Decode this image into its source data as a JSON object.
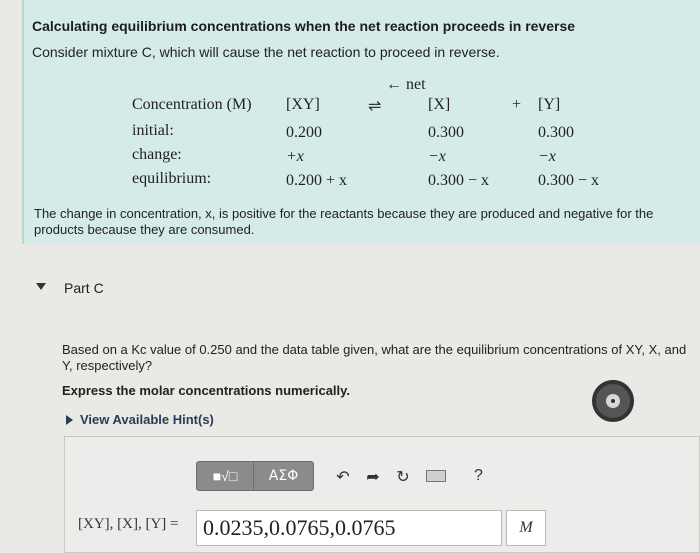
{
  "info": {
    "title": "Calculating equilibrium concentrations when the net reaction proceeds in reverse",
    "subtitle": "Consider mixture C, which will cause the net reaction to proceed in reverse.",
    "net_arrow": "← net",
    "eq_arrows": "⇌",
    "plus": "+",
    "table": {
      "header": [
        "Concentration (M)",
        "[XY]",
        "[X]",
        "[Y]"
      ],
      "rows": [
        {
          "label": "initial:",
          "xy": "0.200",
          "x": "0.300",
          "y": "0.300"
        },
        {
          "label": "change:",
          "xy": "+x",
          "x": "−x",
          "y": "−x"
        },
        {
          "label": "equilibrium:",
          "xy": "0.200 + x",
          "x": "0.300 − x",
          "y": "0.300 − x"
        }
      ]
    },
    "explanation": "The change in concentration, x, is positive for the reactants because they are produced and negative for the products because they are consumed."
  },
  "part": {
    "title": "Part C",
    "question": "Based on a Kc value of 0.250 and the data table given, what are the equilibrium concentrations of XY, X, and Y, respectively?",
    "instruction": "Express the molar concentrations numerically.",
    "hint_link": "View Available Hint(s)"
  },
  "toolbar": {
    "templates_label": "■√□",
    "greek_label": "ΑΣΦ",
    "undo_icon": "undo-icon",
    "redo_icon": "redo-icon",
    "reset_icon": "reset-icon",
    "keyboard_icon": "keyboard-icon",
    "help_label": "?"
  },
  "answer": {
    "label": "[XY], [X], [Y] =",
    "value": "0.0235,0.0765,0.0765",
    "unit": "M"
  }
}
